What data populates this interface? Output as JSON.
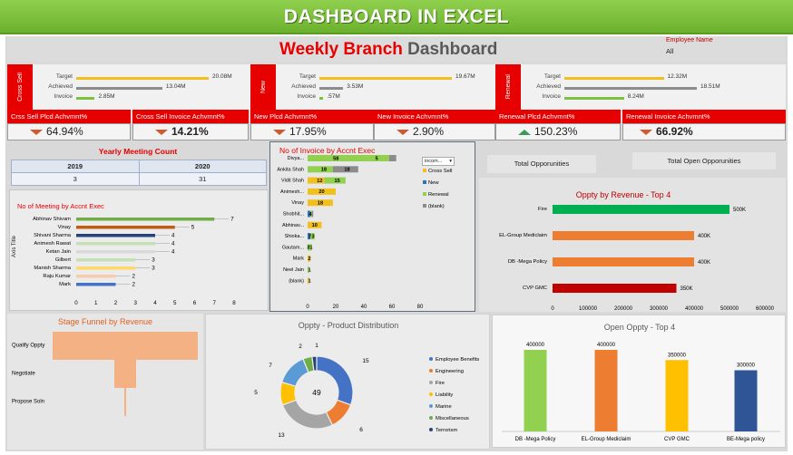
{
  "banner_title": "DASHBOARD IN EXCEL",
  "header": {
    "title_part1": "Weekly Branch",
    "title_part2": "Dashboard",
    "filter_label": "Employee Name",
    "filter_value": "All"
  },
  "sections": [
    {
      "name": "Cross Sell",
      "rows": [
        {
          "label": "Target",
          "value": "20.08M",
          "frac": 1.0,
          "color": "#f2c01e"
        },
        {
          "label": "Achieved",
          "value": "13.04M",
          "frac": 0.65,
          "color": "#8c8c8c"
        },
        {
          "label": "Invoice",
          "value": "2.85M",
          "frac": 0.14,
          "color": "#7cc142"
        }
      ]
    },
    {
      "name": "New",
      "rows": [
        {
          "label": "Target",
          "value": "19.67M",
          "frac": 1.0,
          "color": "#f2c01e"
        },
        {
          "label": "Achieved",
          "value": "3.53M",
          "frac": 0.18,
          "color": "#8c8c8c"
        },
        {
          "label": "Invoice",
          "value": ".57M",
          "frac": 0.03,
          "color": "#7cc142"
        }
      ]
    },
    {
      "name": "Renewal",
      "rows": [
        {
          "label": "Target",
          "value": "12.32M",
          "frac": 0.75,
          "color": "#f2c01e"
        },
        {
          "label": "Achieved",
          "value": "18.51M",
          "frac": 1.0,
          "color": "#8c8c8c"
        },
        {
          "label": "Invoice",
          "value": "8.24M",
          "frac": 0.45,
          "color": "#7cc142"
        }
      ]
    }
  ],
  "kpis": [
    {
      "label": "Crss Sell Plcd Achvmnt%",
      "value": "64.94%",
      "trend": "down"
    },
    {
      "label": "Cross Sell Invoice Achvmnt%",
      "value": "14.21%",
      "trend": "down"
    },
    {
      "label": "New Plcd Achvmnt%",
      "value": "17.95%",
      "trend": "down"
    },
    {
      "label": "New Invoice Achvmnt%",
      "value": "2.90%",
      "trend": "down"
    },
    {
      "label": "Renewal Plcd Achvmnt%",
      "value": "150.23%",
      "trend": "up"
    },
    {
      "label": "Renewal Invoice Achvmnt%",
      "value": "66.92%",
      "trend": "down"
    }
  ],
  "yearly_meeting": {
    "title": "Yearly Meeting Count",
    "years": [
      "2019",
      "2020"
    ],
    "counts": [
      "3",
      "31"
    ]
  },
  "opportunities": {
    "total_label": "Total Opporunities",
    "total_open_label": "Total Open Opporunities"
  },
  "dropdown_value": "incom...",
  "chart_data": [
    {
      "type": "bar",
      "title": "No of Meeting by Accnt Exec",
      "ylabel": "Axis Title",
      "categories": [
        "Abhinav Shivam",
        "Vinay",
        "Shivani Sharma",
        "Animesh Rawat",
        "Ketan Jain",
        "Gilbert",
        "Manish Sharma",
        "Raju Kumar",
        "Mark"
      ],
      "values": [
        7,
        5,
        4,
        4,
        4,
        3,
        3,
        2,
        2
      ],
      "bar_colors": [
        "#70ad47",
        "#c55a11",
        "#264478",
        "#c5e0b4",
        "#d9d9d9",
        "#c5e0b4",
        "#ffd966",
        "#f8cbad",
        "#4472c4"
      ],
      "xlim": [
        0,
        8
      ],
      "xticks": [
        "0",
        "1",
        "2",
        "3",
        "4",
        "5",
        "6",
        "7",
        "8"
      ]
    },
    {
      "type": "bar",
      "title": "No of Invoice by Accnt Exec",
      "categories": [
        "Divya...",
        "Ankita Shah",
        "Vidit Shah",
        "Animesh...",
        "Vinay",
        "Shobhit...",
        "Abhinav...",
        "Shioka...",
        "Gautam...",
        "Mark",
        "Neel Jain",
        "(blank)"
      ],
      "series": [
        {
          "name": "Cross Sell",
          "color": "#f2c01e",
          "values": [
            0,
            0,
            12,
            20,
            18,
            0,
            10,
            0,
            0,
            2,
            0,
            1
          ]
        },
        {
          "name": "New",
          "color": "#2e75b6",
          "values": [
            0,
            0,
            0,
            0,
            0,
            2,
            0,
            2,
            0,
            0,
            0,
            0
          ]
        },
        {
          "name": "Renewal",
          "color": "#92d050",
          "values": [
            58,
            18,
            15,
            0,
            0,
            1,
            0,
            3,
            3,
            0,
            1,
            0
          ]
        },
        {
          "name": "(blank)",
          "color": "#8c8c8c",
          "values": [
            5,
            18,
            0,
            0,
            0,
            1,
            0,
            0,
            0,
            0,
            0,
            0
          ]
        }
      ],
      "labels": [
        [
          "58",
          "5"
        ],
        [
          "18",
          "18"
        ],
        [
          "12",
          "15"
        ],
        [
          "20"
        ],
        [
          "18"
        ],
        [
          "4"
        ],
        [
          "10"
        ],
        [
          "7",
          "3"
        ],
        [
          "31"
        ],
        [
          "2"
        ],
        [
          "1"
        ],
        [
          "1"
        ]
      ],
      "xlim": [
        0,
        80
      ],
      "xticks": [
        "0",
        "20",
        "40",
        "60",
        "80"
      ]
    },
    {
      "type": "bar",
      "title": "Oppty by Revenue - Top 4",
      "categories": [
        "Fire",
        "EL-Group Mediclaim",
        "DB -Mega Policy",
        "CVP GMC"
      ],
      "values": [
        500000,
        400000,
        400000,
        350000
      ],
      "value_labels": [
        "500K",
        "400K",
        "400K",
        "350K"
      ],
      "bar_colors": [
        "#00b050",
        "#ed7d31",
        "#ed7d31",
        "#c00000"
      ],
      "xlim": [
        0,
        600000
      ],
      "xticks": [
        "0",
        "100000",
        "200000",
        "300000",
        "400000",
        "500000",
        "600000"
      ]
    },
    {
      "type": "bar",
      "title": "Stage Funnel by Revenue",
      "categories": [
        "Qualify Oppty",
        "Negotiate",
        "Propose Soln"
      ],
      "fracs": [
        1.0,
        0.15,
        0.01
      ],
      "color": "#f4b183"
    },
    {
      "type": "pie",
      "title": "Oppty - Product Distribution",
      "center_label": "49",
      "categories": [
        "Employee Benefits",
        "Engineering",
        "Fire",
        "Liability",
        "Marine",
        "Miscellaneous",
        "Terrorism"
      ],
      "values": [
        15,
        6,
        13,
        5,
        7,
        2,
        1
      ],
      "colors": [
        "#4472c4",
        "#ed7d31",
        "#a5a5a5",
        "#ffc000",
        "#5b9bd5",
        "#70ad47",
        "#264478"
      ],
      "value_labels": [
        "15",
        "6",
        "13",
        "5",
        "7",
        "2",
        "1"
      ]
    },
    {
      "type": "bar",
      "title": "Open Oppty - Top 4",
      "categories": [
        "DB -Mega Policy",
        "EL-Group Mediclaim",
        "CVP GMC",
        "BE-Mega policy"
      ],
      "values": [
        400000,
        400000,
        350000,
        300000
      ],
      "value_labels": [
        "400000",
        "400000",
        "350000",
        "300000"
      ],
      "bar_colors": [
        "#92d050",
        "#ed7d31",
        "#ffc000",
        "#2f5597"
      ],
      "ylim": [
        0,
        400000
      ]
    }
  ]
}
